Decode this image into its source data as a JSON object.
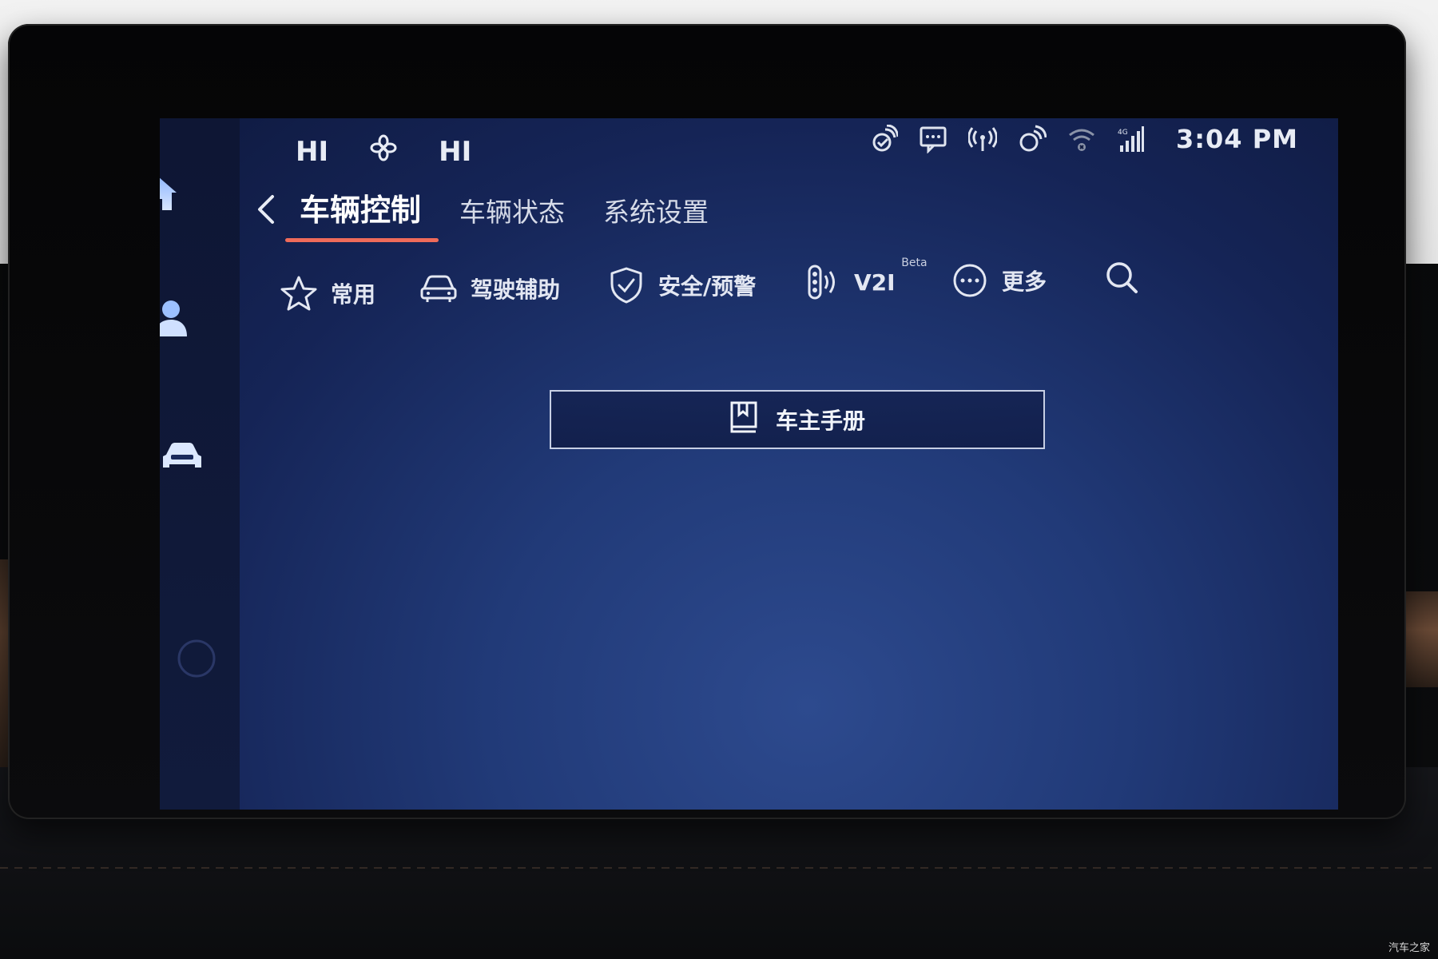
{
  "climate": {
    "left_temp": "HI",
    "fan_icon": "fan-icon",
    "right_temp": "HI"
  },
  "status": {
    "time": "3:04 PM",
    "icons": [
      "connected-services-icon",
      "message-icon",
      "broadcast-icon",
      "satellite-icon",
      "wifi-disconnected-icon",
      "4g-signal-icon"
    ]
  },
  "sidebar": {
    "items": [
      "home-icon",
      "profile-icon",
      "vehicle-icon",
      "night-mode-icon"
    ]
  },
  "tabs": [
    {
      "label": "车辆控制",
      "active": true
    },
    {
      "label": "车辆状态",
      "active": false
    },
    {
      "label": "系统设置",
      "active": false
    }
  ],
  "subnav": {
    "common": "常用",
    "driving_assist": "驾驶辅助",
    "safety": "安全/预警",
    "v2i": "V2I",
    "v2i_badge": "Beta",
    "more": "更多"
  },
  "manual_button": {
    "label": "车主手册"
  },
  "watermark": "汽车之家",
  "colors": {
    "accent": "#ef6b5a",
    "text": "#e8ecf5",
    "screen_bg": "#1b2d66",
    "sidebar_bg": "#0e1634"
  }
}
